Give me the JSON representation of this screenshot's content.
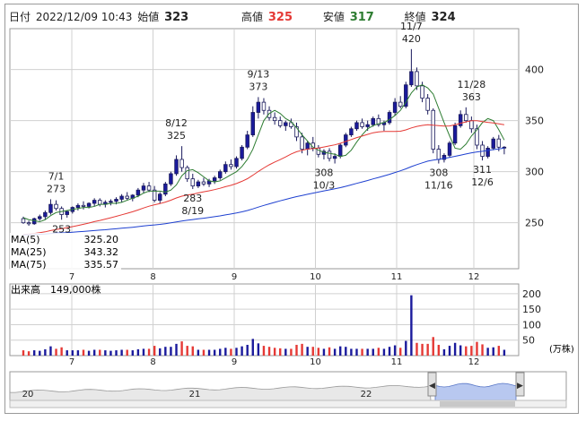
{
  "header": {
    "date_label": "日付",
    "datetime": "2022/12/09 10:43",
    "open_label": "始値",
    "open": "323",
    "high_label": "高値",
    "high": "325",
    "low_label": "安値",
    "low": "317",
    "close_label": "終値",
    "close": "324"
  },
  "colors": {
    "up_candle": "#1a1a9c",
    "down_candle": "#ffffff",
    "ma5": "#2e7d32",
    "ma25": "#e53935",
    "ma75": "#1e40d0",
    "volume_up": "#1a1a9c",
    "volume_down": "#e53935",
    "high_value": "#e53935",
    "low_value": "#2e7d32",
    "grid": "#d0d0d0",
    "navigator_fill": "#b8c8f0"
  },
  "legend": {
    "ma5_label": "MA(5)",
    "ma5_value": "325.20",
    "ma25_label": "MA(25)",
    "ma25_value": "343.32",
    "ma75_label": "MA(75)",
    "ma75_value": "335.57"
  },
  "volume_panel": {
    "title": "出来高",
    "value": "149,000株",
    "unit": "(万株)"
  },
  "chart_data": {
    "type": "candlestick",
    "price_axis": {
      "ticks": [
        250,
        300,
        350,
        400
      ],
      "ylim": [
        205,
        440
      ]
    },
    "volume_axis": {
      "ticks": [
        50,
        100,
        150,
        200
      ],
      "ylim": [
        0,
        220
      ]
    },
    "x_month_labels": [
      "7",
      "8",
      "9",
      "10",
      "11",
      "12"
    ],
    "navigator_labels": [
      "20",
      "21",
      "22"
    ],
    "annotations": [
      {
        "text": "7/1",
        "price": 273,
        "pos": "above"
      },
      {
        "text": "273",
        "price": 273,
        "pos": "above"
      },
      {
        "text": "253",
        "price": 253,
        "pos": "below"
      },
      {
        "text": "8/12",
        "price": 325,
        "pos": "above"
      },
      {
        "text": "325",
        "price": 325,
        "pos": "above"
      },
      {
        "text": "283",
        "price": 283,
        "pos": "below"
      },
      {
        "text": "8/19",
        "price": 283,
        "pos": "below"
      },
      {
        "text": "9/13",
        "price": 373,
        "pos": "above"
      },
      {
        "text": "373",
        "price": 373,
        "pos": "above"
      },
      {
        "text": "308",
        "price": 308,
        "pos": "below"
      },
      {
        "text": "10/3",
        "price": 308,
        "pos": "below"
      },
      {
        "text": "11/7",
        "price": 420,
        "pos": "above"
      },
      {
        "text": "420",
        "price": 420,
        "pos": "above"
      },
      {
        "text": "11/28",
        "price": 363,
        "pos": "above"
      },
      {
        "text": "363",
        "price": 363,
        "pos": "above"
      },
      {
        "text": "308",
        "price": 308,
        "pos": "below"
      },
      {
        "text": "11/16",
        "price": 308,
        "pos": "below"
      },
      {
        "text": "311",
        "price": 311,
        "pos": "below"
      },
      {
        "text": "12/6",
        "price": 311,
        "pos": "below"
      }
    ],
    "candles": [
      [
        254,
        256,
        249,
        250
      ],
      [
        250,
        252,
        247,
        249
      ],
      [
        249,
        255,
        248,
        254
      ],
      [
        254,
        258,
        252,
        256
      ],
      [
        256,
        262,
        253,
        260
      ],
      [
        260,
        273,
        258,
        268
      ],
      [
        268,
        272,
        262,
        264
      ],
      [
        264,
        266,
        253,
        258
      ],
      [
        258,
        262,
        255,
        261
      ],
      [
        261,
        266,
        259,
        265
      ],
      [
        265,
        269,
        262,
        267
      ],
      [
        267,
        271,
        263,
        266
      ],
      [
        266,
        270,
        264,
        269
      ],
      [
        269,
        274,
        266,
        272
      ],
      [
        272,
        274,
        266,
        268
      ],
      [
        268,
        272,
        265,
        270
      ],
      [
        270,
        273,
        267,
        271
      ],
      [
        271,
        275,
        268,
        273
      ],
      [
        273,
        278,
        270,
        276
      ],
      [
        276,
        280,
        272,
        274
      ],
      [
        274,
        278,
        271,
        277
      ],
      [
        277,
        284,
        275,
        282
      ],
      [
        282,
        289,
        279,
        286
      ],
      [
        286,
        290,
        280,
        282
      ],
      [
        282,
        286,
        270,
        272
      ],
      [
        272,
        280,
        269,
        278
      ],
      [
        278,
        290,
        276,
        288
      ],
      [
        288,
        300,
        286,
        298
      ],
      [
        298,
        316,
        296,
        312
      ],
      [
        312,
        325,
        300,
        304
      ],
      [
        304,
        306,
        290,
        293
      ],
      [
        293,
        298,
        283,
        286
      ],
      [
        286,
        292,
        284,
        290
      ],
      [
        290,
        294,
        286,
        288
      ],
      [
        288,
        293,
        285,
        291
      ],
      [
        291,
        296,
        288,
        294
      ],
      [
        294,
        302,
        292,
        300
      ],
      [
        300,
        310,
        298,
        307
      ],
      [
        307,
        312,
        302,
        305
      ],
      [
        305,
        315,
        303,
        313
      ],
      [
        313,
        326,
        311,
        324
      ],
      [
        324,
        340,
        322,
        336
      ],
      [
        336,
        364,
        334,
        358
      ],
      [
        358,
        373,
        352,
        368
      ],
      [
        368,
        372,
        356,
        360
      ],
      [
        360,
        364,
        350,
        353
      ],
      [
        353,
        358,
        346,
        350
      ],
      [
        350,
        354,
        343,
        345
      ],
      [
        345,
        350,
        340,
        348
      ],
      [
        348,
        352,
        342,
        344
      ],
      [
        344,
        348,
        330,
        334
      ],
      [
        334,
        338,
        318,
        322
      ],
      [
        322,
        330,
        316,
        328
      ],
      [
        328,
        334,
        320,
        323
      ],
      [
        323,
        326,
        314,
        317
      ],
      [
        317,
        322,
        312,
        320
      ],
      [
        320,
        323,
        310,
        313
      ],
      [
        313,
        318,
        308,
        315
      ],
      [
        315,
        328,
        313,
        326
      ],
      [
        326,
        338,
        324,
        336
      ],
      [
        336,
        344,
        334,
        342
      ],
      [
        342,
        350,
        340,
        348
      ],
      [
        348,
        352,
        342,
        344
      ],
      [
        344,
        350,
        340,
        346
      ],
      [
        346,
        354,
        344,
        352
      ],
      [
        352,
        356,
        344,
        346
      ],
      [
        346,
        350,
        340,
        348
      ],
      [
        348,
        360,
        346,
        358
      ],
      [
        358,
        372,
        355,
        368
      ],
      [
        368,
        374,
        362,
        364
      ],
      [
        364,
        388,
        362,
        385
      ],
      [
        385,
        420,
        383,
        398
      ],
      [
        398,
        402,
        380,
        384
      ],
      [
        384,
        388,
        368,
        372
      ],
      [
        372,
        376,
        356,
        360
      ],
      [
        360,
        362,
        318,
        322
      ],
      [
        322,
        326,
        308,
        312
      ],
      [
        312,
        318,
        309,
        316
      ],
      [
        316,
        330,
        314,
        328
      ],
      [
        328,
        348,
        326,
        345
      ],
      [
        345,
        360,
        343,
        356
      ],
      [
        356,
        363,
        348,
        350
      ],
      [
        350,
        354,
        338,
        342
      ],
      [
        342,
        346,
        322,
        326
      ],
      [
        326,
        330,
        311,
        315
      ],
      [
        315,
        325,
        313,
        323
      ],
      [
        323,
        334,
        321,
        332
      ],
      [
        332,
        336,
        320,
        324
      ],
      [
        324,
        325,
        317,
        324
      ]
    ],
    "ma5": [
      255,
      253,
      252,
      251,
      253,
      257,
      260,
      261,
      262,
      263,
      264,
      265,
      265,
      266,
      268,
      268,
      269,
      269,
      270,
      272,
      274,
      276,
      279,
      281,
      281,
      281,
      280,
      282,
      287,
      296,
      301,
      302,
      299,
      295,
      291,
      290,
      291,
      294,
      297,
      300,
      305,
      312,
      322,
      336,
      350,
      357,
      360,
      357,
      352,
      349,
      343,
      336,
      330,
      324,
      321,
      319,
      318,
      317,
      315,
      316,
      321,
      329,
      336,
      342,
      345,
      347,
      348,
      351,
      355,
      360,
      368,
      377,
      383,
      385,
      382,
      376,
      362,
      348,
      335,
      323,
      322,
      327,
      335,
      341,
      348,
      352,
      350,
      341,
      331,
      324,
      325
    ]
  }
}
